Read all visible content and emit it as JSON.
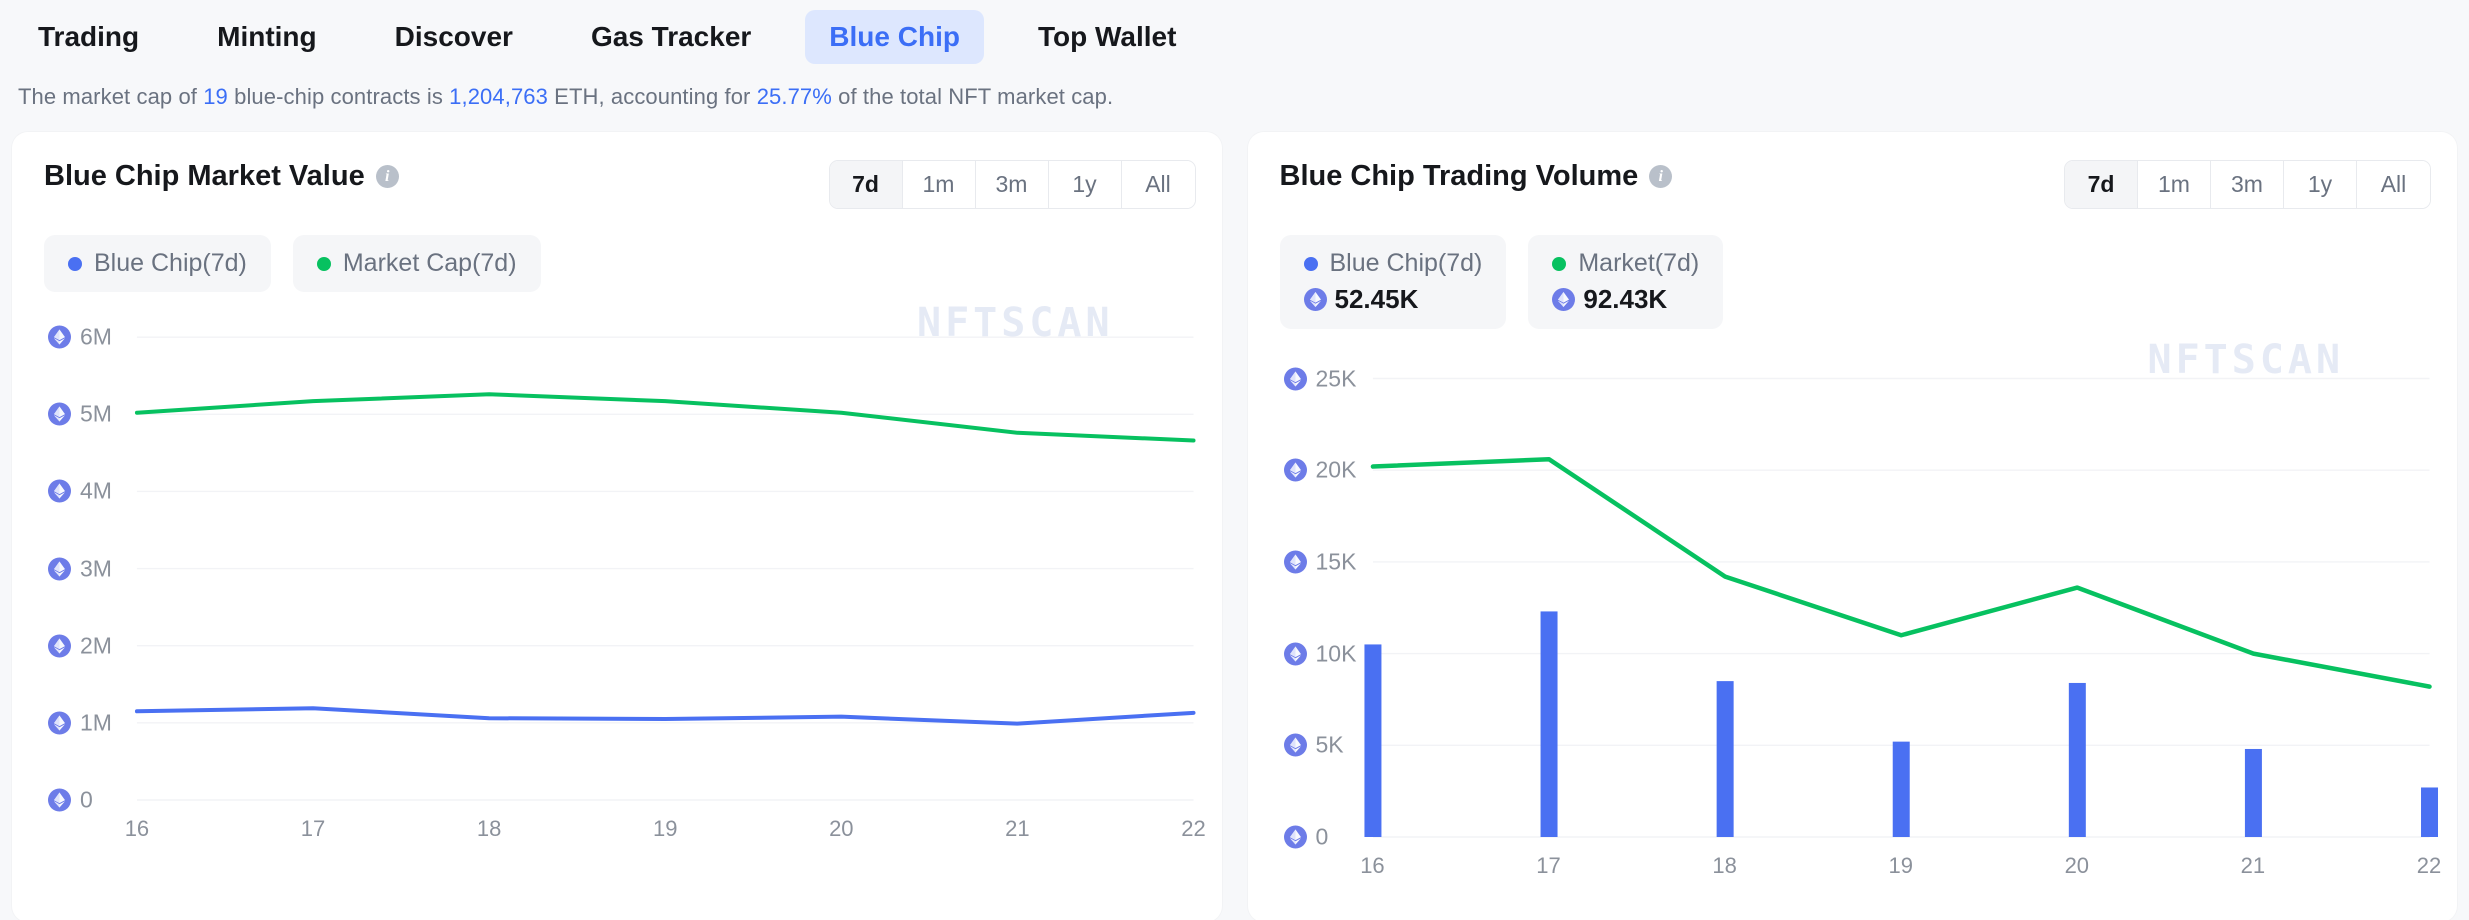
{
  "nav": {
    "tabs": [
      {
        "label": "Trading",
        "active": false
      },
      {
        "label": "Minting",
        "active": false
      },
      {
        "label": "Discover",
        "active": false
      },
      {
        "label": "Gas Tracker",
        "active": false
      },
      {
        "label": "Blue Chip",
        "active": true
      },
      {
        "label": "Top Wallet",
        "active": false
      }
    ]
  },
  "subtitle": {
    "p1": "The market cap of ",
    "count": "19",
    "p2": " blue-chip contracts is ",
    "marketcap": "1,204,763",
    "p3": " ETH, accounting for ",
    "percent": "25.77%",
    "p4": " of the total NFT market cap."
  },
  "colors": {
    "blue": "#4a70f2",
    "green": "#07c160",
    "accent": "#3b6ef6",
    "eth": "#6d7ce8",
    "grid": "#f2f3f6",
    "muted": "#8b919b"
  },
  "left_card": {
    "title": "Blue Chip Market Value",
    "info_icon": "info-icon",
    "watermark": "NFTSCAN",
    "ranges": [
      {
        "label": "7d",
        "active": true
      },
      {
        "label": "1m",
        "active": false
      },
      {
        "label": "3m",
        "active": false
      },
      {
        "label": "1y",
        "active": false
      },
      {
        "label": "All",
        "active": false
      }
    ],
    "legend": [
      {
        "label": "Blue Chip(7d)",
        "dot": "#4a70f2",
        "value": null
      },
      {
        "label": "Market Cap(7d)",
        "dot": "#07c160",
        "value": null
      }
    ]
  },
  "right_card": {
    "title": "Blue Chip Trading Volume",
    "info_icon": "info-icon",
    "watermark": "NFTSCAN",
    "ranges": [
      {
        "label": "7d",
        "active": true
      },
      {
        "label": "1m",
        "active": false
      },
      {
        "label": "3m",
        "active": false
      },
      {
        "label": "1y",
        "active": false
      },
      {
        "label": "All",
        "active": false
      }
    ],
    "legend": [
      {
        "label": "Blue Chip(7d)",
        "dot": "#4a70f2",
        "value": "52.45K",
        "eth": true
      },
      {
        "label": "Market(7d)",
        "dot": "#07c160",
        "value": "92.43K",
        "eth": true
      }
    ]
  },
  "chart_data": [
    {
      "id": "blue-chip-market-value",
      "type": "line",
      "title": "Blue Chip Market Value",
      "xlabel": "",
      "ylabel": "ETH",
      "x": [
        16,
        17,
        18,
        19,
        20,
        21,
        22
      ],
      "xticks": [
        "16",
        "17",
        "18",
        "19",
        "20",
        "21",
        "22"
      ],
      "yticks": [
        "0",
        "1M",
        "2M",
        "3M",
        "4M",
        "5M",
        "6M"
      ],
      "ytick_values": [
        0,
        1000000,
        2000000,
        3000000,
        4000000,
        5000000,
        6000000
      ],
      "ylim": [
        0,
        6300000
      ],
      "grid": true,
      "legend_position": "top-left",
      "series": [
        {
          "name": "Market Cap(7d)",
          "color": "#07c160",
          "values": [
            5020000,
            5170000,
            5260000,
            5170000,
            5020000,
            4760000,
            4660000
          ]
        },
        {
          "name": "Blue Chip(7d)",
          "color": "#4a70f2",
          "values": [
            1150000,
            1190000,
            1060000,
            1050000,
            1080000,
            990000,
            1130000
          ]
        }
      ]
    },
    {
      "id": "blue-chip-trading-volume",
      "type": "bar+line",
      "title": "Blue Chip Trading Volume",
      "xlabel": "",
      "ylabel": "ETH",
      "x": [
        16,
        17,
        18,
        19,
        20,
        21,
        22
      ],
      "xticks": [
        "16",
        "17",
        "18",
        "19",
        "20",
        "21",
        "22"
      ],
      "yticks": [
        "0",
        "5K",
        "10K",
        "15K",
        "20K",
        "25K"
      ],
      "ytick_values": [
        0,
        5000,
        10000,
        15000,
        20000,
        25000
      ],
      "ylim": [
        0,
        26500
      ],
      "grid": true,
      "legend_position": "top-left",
      "series": [
        {
          "name": "Blue Chip(7d)",
          "type": "bar",
          "color": "#4a70f2",
          "values": [
            10500,
            12300,
            8500,
            5200,
            8400,
            4800,
            2700
          ],
          "total": "52.45K"
        },
        {
          "name": "Market(7d)",
          "type": "line",
          "color": "#07c160",
          "values": [
            20200,
            20600,
            14200,
            11000,
            13600,
            10000,
            8200
          ],
          "total": "92.43K"
        }
      ]
    }
  ]
}
